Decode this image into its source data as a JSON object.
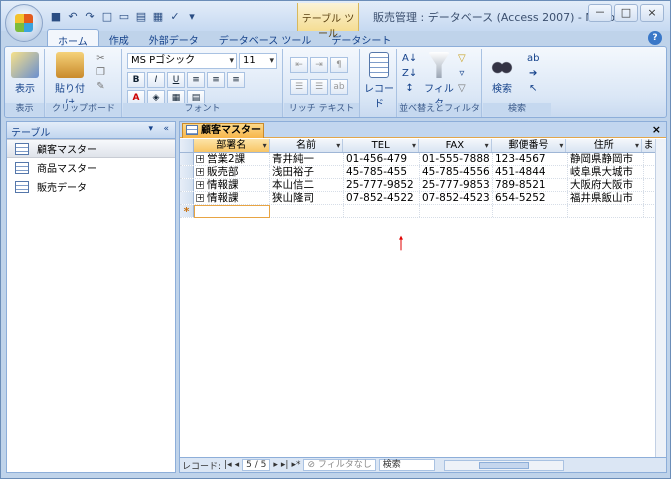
{
  "window": {
    "title": "販売管理 : データベース (Access 2007) - Microso...",
    "context_tab": "テーブル ツール",
    "minimize": "－",
    "maximize": "□",
    "close": "×"
  },
  "ribbon_tabs": [
    "ホーム",
    "作成",
    "外部データ",
    "データベース ツール",
    "データシート"
  ],
  "ribbon": {
    "view_label": "表示",
    "view_group": "表示",
    "paste_label": "貼り付け",
    "clipboard_group": "クリップボード",
    "font_name": "MS Pゴシック",
    "font_size": "11",
    "font_group": "フォント",
    "richtext_group": "リッチ テキスト",
    "record_label": "レコード",
    "filter_label": "フィルタ",
    "sort_group": "並べ替えとフィルタ",
    "find_label": "検索",
    "find_group": "検索"
  },
  "nav": {
    "header": "テーブル",
    "items": [
      "顧客マスター",
      "商品マスター",
      "販売データ"
    ]
  },
  "document": {
    "tab": "顧客マスター",
    "columns": [
      "部署名",
      "名前",
      "TEL",
      "FAX",
      "郵便番号",
      "住所",
      "ま"
    ],
    "rows": [
      [
        "営業2課",
        "青井純一",
        "01-456-479",
        "01-555-7888",
        "123-4567",
        "静岡県静岡市"
      ],
      [
        "販売部",
        "浅田裕子",
        "45-785-455",
        "45-785-4556",
        "451-4844",
        "岐阜県大城市"
      ],
      [
        "情報課",
        "本山信二",
        "25-777-9852",
        "25-777-9853",
        "789-8521",
        "大阪府大阪市"
      ],
      [
        "情報課",
        "狭山隆司",
        "07-852-4522",
        "07-852-4523",
        "654-5252",
        "福井県飯山市"
      ]
    ],
    "new_row_marker": "*"
  },
  "status": {
    "record_label": "レコード:",
    "record_pos": "5 / 5",
    "filter": "フィルタなし",
    "search": "検索"
  },
  "colors": {
    "annotation_arrow": "#e00000",
    "tab_orange": "#f7b54a"
  }
}
